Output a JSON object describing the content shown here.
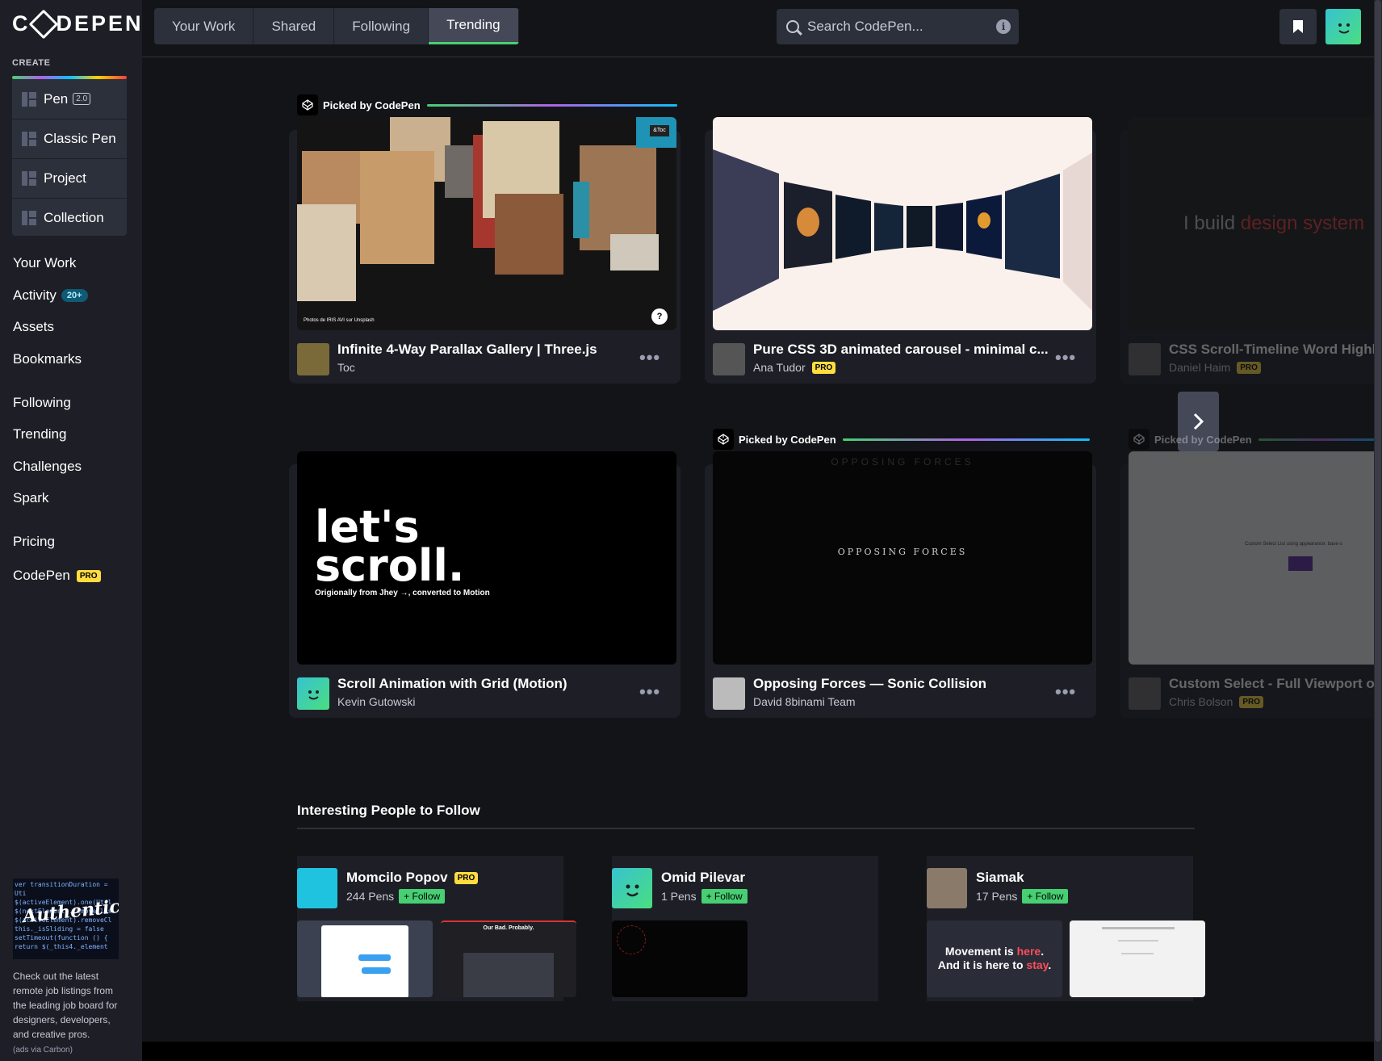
{
  "brand": {
    "logo": "CODEPEN"
  },
  "sidebar": {
    "create_label": "CREATE",
    "create_items": [
      {
        "label": "Pen",
        "badge": "2.0"
      },
      {
        "label": "Classic Pen"
      },
      {
        "label": "Project"
      },
      {
        "label": "Collection"
      }
    ],
    "links_group1": [
      {
        "label": "Your Work"
      },
      {
        "label": "Activity",
        "badge": "20+"
      },
      {
        "label": "Assets"
      },
      {
        "label": "Bookmarks"
      }
    ],
    "links_group2": [
      {
        "label": "Following"
      },
      {
        "label": "Trending"
      },
      {
        "label": "Challenges"
      },
      {
        "label": "Spark"
      }
    ],
    "links_group3": [
      {
        "label": "Pricing"
      },
      {
        "label": "CodePen",
        "badge": "PRO"
      }
    ],
    "ad": {
      "image_word": "Authentic",
      "text": "Check out the latest remote job listings from the leading job board for designers, developers, and creative pros.",
      "via": "(ads via Carbon)"
    }
  },
  "header": {
    "tabs": [
      {
        "label": "Your Work",
        "active": false
      },
      {
        "label": "Shared",
        "active": false
      },
      {
        "label": "Following",
        "active": false
      },
      {
        "label": "Trending",
        "active": true
      }
    ],
    "search_placeholder": "Search CodePen...",
    "info_label": "i"
  },
  "picked_label": "Picked by CodePen",
  "pens": [
    {
      "title": "Infinite 4-Way Parallax Gallery | Three.js",
      "author": "Toc",
      "pro": false,
      "picked": true,
      "thumb_caption": "Photos de IRIS AVI sur Unsplash",
      "thumb_tag": "&Toc",
      "thumb_help": "?"
    },
    {
      "title": "Pure CSS 3D animated carousel - minimal c...",
      "author": "Ana Tudor",
      "pro": true,
      "picked": false
    },
    {
      "title": "CSS Scroll-Timeline Word Highlig",
      "author": "Daniel Haim",
      "pro": true,
      "picked": false,
      "thumb_text_a": "I build ",
      "thumb_text_b": "design system"
    },
    {
      "title": "Scroll Animation with Grid (Motion)",
      "author": "Kevin Gutowski",
      "pro": false,
      "picked": false,
      "thumb_big": "let's scroll.",
      "thumb_small": "Origionally from Jhey →, converted to Motion"
    },
    {
      "title": "Opposing Forces — Sonic Collision",
      "author": "David 8binami Team",
      "pro": false,
      "picked": true,
      "thumb_top": "OPPOSING FORCES",
      "thumb_mid": "OPPOSING FORCES"
    },
    {
      "title": "Custom Select - Full Viewport op",
      "author": "Chris Bolson",
      "pro": true,
      "picked": true,
      "thumb_text": "Custom Select List using appearance: base-s"
    }
  ],
  "pro_badge": "PRO",
  "more_dots": "•••",
  "people": {
    "title": "Interesting People to Follow",
    "follow_label": "+ Follow",
    "list": [
      {
        "name": "Momcilo Popov",
        "pro": true,
        "pens": "244 Pens",
        "thumb2_title": "Our Bad. Probably."
      },
      {
        "name": "Omid Pilevar",
        "pro": false,
        "pens": "1 Pens"
      },
      {
        "name": "Siamak",
        "pro": false,
        "pens": "17 Pens",
        "thumb1_a": "Movement is ",
        "thumb1_b": "here",
        "thumb1_c": ".",
        "thumb1_d": "And it is here to ",
        "thumb1_e": "stay",
        "thumb1_f": "."
      }
    ]
  },
  "colors": {
    "accent_green": "#47cf73",
    "pro_yellow": "#ffdd40",
    "bg": "#131417",
    "panel": "#1e1f26",
    "control": "#2c303a"
  }
}
